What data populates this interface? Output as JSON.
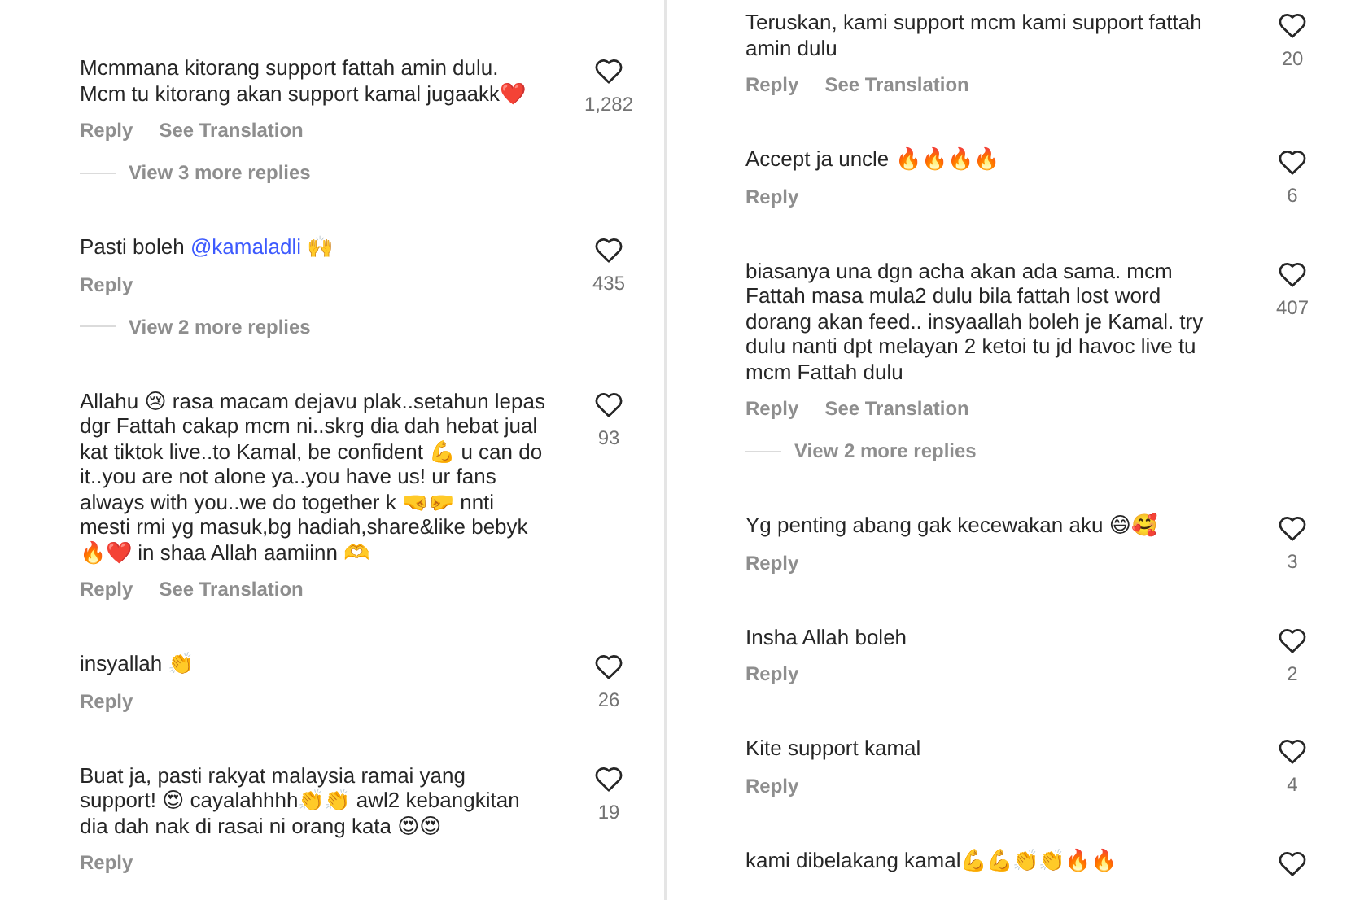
{
  "columns": [
    {
      "comments": [
        {
          "parts": [
            {
              "kind": "text",
              "text": "Mcmmana kitorang support fattah amin dulu.  Mcm tu kitorang akan support kamal jugaakk❤️"
            }
          ],
          "likes": "1,282",
          "actions": [
            "Reply",
            "See Translation"
          ],
          "view_replies": "View 3 more replies"
        },
        {
          "parts": [
            {
              "kind": "text",
              "text": "Pasti boleh "
            },
            {
              "kind": "mention",
              "text": "@kamaladli"
            },
            {
              "kind": "text",
              "text": " 🙌"
            }
          ],
          "likes": "435",
          "actions": [
            "Reply"
          ],
          "view_replies": "View 2 more replies"
        },
        {
          "parts": [
            {
              "kind": "text",
              "text": "Allahu 😢 rasa macam dejavu plak..setahun lepas dgr Fattah cakap mcm ni..skrg dia dah hebat jual kat tiktok live..to Kamal, be confident 💪 u can do it..you are not alone ya..you have us! ur fans always with you..we do together k 🤜🤛 nnti mesti rmi yg masuk,bg hadiah,share&like bebyk 🔥❤️ in shaa Allah aamiinn 🫶"
            }
          ],
          "likes": "93",
          "actions": [
            "Reply",
            "See Translation"
          ]
        },
        {
          "parts": [
            {
              "kind": "text",
              "text": "insyallah 👏"
            }
          ],
          "likes": "26",
          "actions": [
            "Reply"
          ]
        },
        {
          "parts": [
            {
              "kind": "text",
              "text": "Buat ja, pasti rakyat malaysia ramai  yang support! 😍 cayalahhhh👏👏 awl2 kebangkitan dia dah nak di rasai ni orang kata 😍😍"
            }
          ],
          "likes": "19",
          "actions": [
            "Reply"
          ]
        }
      ]
    },
    {
      "comments": [
        {
          "parts": [
            {
              "kind": "text",
              "text": "Teruskan, kami support mcm kami support fattah amin dulu"
            }
          ],
          "likes": "20",
          "actions": [
            "Reply",
            "See Translation"
          ]
        },
        {
          "parts": [
            {
              "kind": "text",
              "text": "Accept ja uncle 🔥🔥🔥🔥"
            }
          ],
          "likes": "6",
          "actions": [
            "Reply"
          ]
        },
        {
          "parts": [
            {
              "kind": "text",
              "text": "biasanya una dgn acha akan ada sama. mcm Fattah masa mula2 dulu bila fattah lost word dorang akan feed.. insyaallah boleh je Kamal. try dulu nanti dpt melayan 2 ketoi tu jd havoc live tu mcm Fattah dulu"
            }
          ],
          "likes": "407",
          "actions": [
            "Reply",
            "See Translation"
          ],
          "view_replies": "View 2 more replies"
        },
        {
          "parts": [
            {
              "kind": "text",
              "text": "Yg penting abang gak kecewakan aku 😄🥰"
            }
          ],
          "likes": "3",
          "actions": [
            "Reply"
          ]
        },
        {
          "parts": [
            {
              "kind": "text",
              "text": "Insha Allah boleh"
            }
          ],
          "likes": "2",
          "actions": [
            "Reply"
          ]
        },
        {
          "parts": [
            {
              "kind": "text",
              "text": "Kite support kamal"
            }
          ],
          "likes": "4",
          "actions": [
            "Reply"
          ]
        },
        {
          "parts": [
            {
              "kind": "text",
              "text": "kami dibelakang kamal💪💪👏👏🔥🔥"
            }
          ]
        }
      ]
    }
  ]
}
